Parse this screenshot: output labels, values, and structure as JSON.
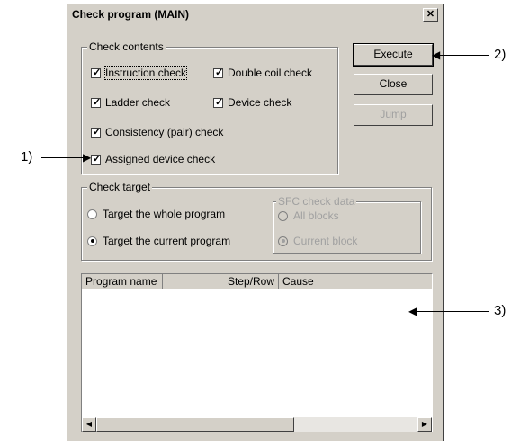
{
  "dialog": {
    "title": "Check program (MAIN)",
    "close_glyph": "✕"
  },
  "check_contents": {
    "legend": "Check contents",
    "items": [
      {
        "label": "Instruction check",
        "checked": true
      },
      {
        "label": "Double coil check",
        "checked": true
      },
      {
        "label": "Ladder check",
        "checked": true
      },
      {
        "label": "Device check",
        "checked": true
      },
      {
        "label": "Consistency (pair) check",
        "checked": true
      },
      {
        "label": "Assigned device check",
        "checked": true
      }
    ]
  },
  "buttons": {
    "execute": "Execute",
    "close": "Close",
    "jump": "Jump"
  },
  "check_target": {
    "legend": "Check target",
    "options": [
      {
        "label": "Target the whole program",
        "selected": false
      },
      {
        "label": "Target the current program",
        "selected": true
      }
    ],
    "sfc": {
      "legend": "SFC check data",
      "options": [
        {
          "label": "All blocks",
          "selected": false
        },
        {
          "label": "Current block",
          "selected": true
        }
      ]
    }
  },
  "results_list": {
    "columns": [
      "Program name",
      "Step/Row",
      "Cause"
    ]
  },
  "callouts": {
    "c1": "1)",
    "c2": "2)",
    "c3": "3)"
  }
}
